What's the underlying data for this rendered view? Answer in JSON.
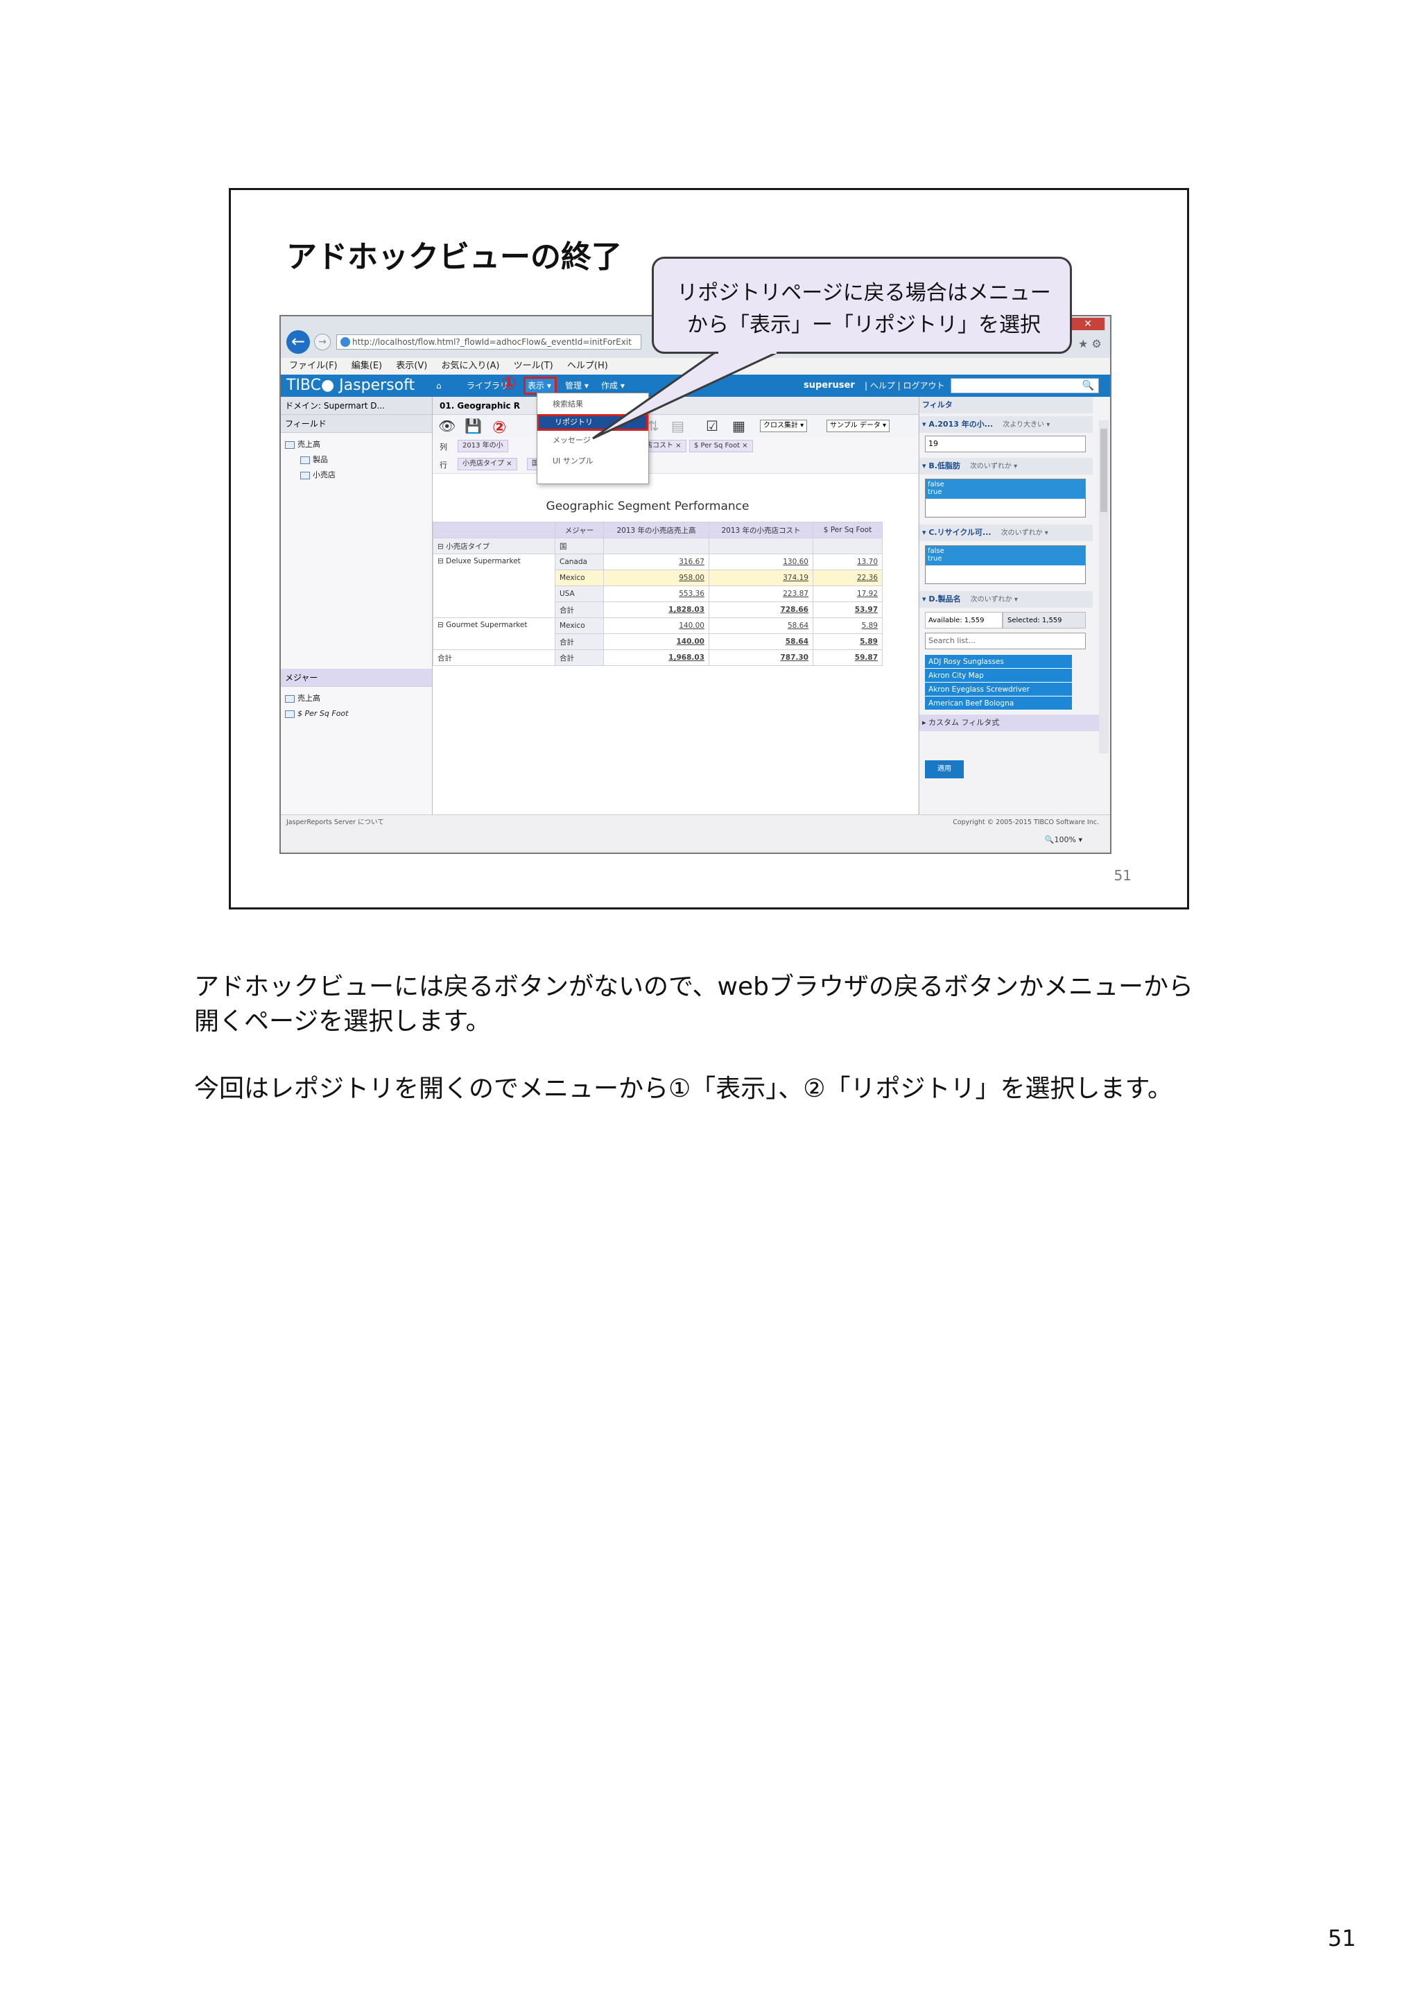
{
  "slide": {
    "title": "アドホックビューの終了",
    "number": "51",
    "callout_line1": "リポジトリページに戻る場合はメニュー",
    "callout_line2": "から「表示」ー「リポジトリ」を選択",
    "marker1": "①",
    "marker2": "②"
  },
  "browser": {
    "url": "http://localhost/flow.html?_flowId=adhocFlow&_eventId=initForExit",
    "back_glyph": "←",
    "forward_glyph": "→",
    "close_glyph": "✕",
    "menu": [
      "ファイル(F)",
      "編集(E)",
      "表示(V)",
      "お気に入り(A)",
      "ツール(T)",
      "ヘルプ(H)"
    ]
  },
  "jaspersoft": {
    "brand": "TIBC● Jaspersoft",
    "home_glyph": "⌂",
    "nav": [
      "ライブラリ",
      "表示 ▾",
      "管理 ▾",
      "作成 ▾"
    ],
    "user": "superuser",
    "links": "| ヘルプ | ログアウト",
    "search_icon": "🔍"
  },
  "left_panel": {
    "domain": "ドメイン: Supermart D...",
    "fields_header": "フィールド",
    "fields": [
      "売上高",
      "製品",
      "小売店"
    ],
    "measures_header": "メジャー",
    "measures": [
      "売上高",
      "$ Per Sq Foot"
    ]
  },
  "center": {
    "view_title": "01. Geographic R",
    "columns_label": "列",
    "rows_label": "行",
    "column_chips": [
      "2013 年の小",
      "売店コスト ×",
      "$ Per Sq Foot ×"
    ],
    "row_chips": [
      "小売店タイプ ×",
      "国 ×"
    ],
    "crosstab_btn": "クロス集計 ▾",
    "sample_btn": "サンプル データ ▾"
  },
  "menu_items": [
    "検索結果",
    "リポジトリ",
    "メッセージ",
    "UI サンプル"
  ],
  "report": {
    "title": "Geographic Segment Performance",
    "header_measures": "メジャー",
    "col_headers": [
      "2013 年の小売店売上高",
      "2013 年の小売店コスト",
      "$ Per Sq Foot"
    ],
    "row_header1": "小売店タイプ",
    "row_header2": "国",
    "rows": [
      {
        "type": "Deluxe Supermarket",
        "country": "Canada",
        "v1": "316.67",
        "v2": "130.60",
        "v3": "13.70"
      },
      {
        "type": "",
        "country": "Mexico",
        "v1": "958.00",
        "v2": "374.19",
        "v3": "22.36"
      },
      {
        "type": "",
        "country": "USA",
        "v1": "553.36",
        "v2": "223.87",
        "v3": "17.92"
      },
      {
        "type": "",
        "country": "合計",
        "v1": "1,828.03",
        "v2": "728.66",
        "v3": "53.97"
      },
      {
        "type": "Gourmet Supermarket",
        "country": "Mexico",
        "v1": "140.00",
        "v2": "58.64",
        "v3": "5.89"
      },
      {
        "type": "",
        "country": "合計",
        "v1": "140.00",
        "v2": "58.64",
        "v3": "5.89"
      },
      {
        "type": "合計",
        "country": "合計",
        "v1": "1,968.03",
        "v2": "787.30",
        "v3": "59.87"
      }
    ]
  },
  "filters": {
    "header": "フィルタ",
    "a_label": "A.2013 年の小...",
    "a_op": "次より大きい ▾",
    "a_value": "19",
    "b_label": "B.低脂肪",
    "b_op": "次のいずれか ▾",
    "c_label": "C.リサイクル可...",
    "c_op": "次のいずれか ▾",
    "d_label": "D.製品名",
    "d_op": "次のいずれか ▾",
    "bool_false": "false",
    "bool_true": "true",
    "available": "Available: 1,559",
    "selected": "Selected: 1,559",
    "search_placeholder": "Search list...",
    "products": [
      "ADJ Rosy Sunglasses",
      "Akron City Map",
      "Akron Eyeglass Screwdriver",
      "American Beef Bologna"
    ],
    "custom_filter": "カスタム フィルタ式",
    "apply": "適用"
  },
  "footer": {
    "about": "JasperReports Server について",
    "copyright": "Copyright © 2005-2015 TIBCO Software Inc.",
    "zoom": "100%"
  },
  "body": {
    "para1_line1": "アドホックビューには戻るボタンがないので、webブラウザの戻るボタンかメニューから",
    "para1_line2": "開くページを選択します。",
    "para2": "今回はレポジトリを開くのでメニューから①「表示」、②「リポジトリ」を選択します。"
  },
  "page_number": "51"
}
